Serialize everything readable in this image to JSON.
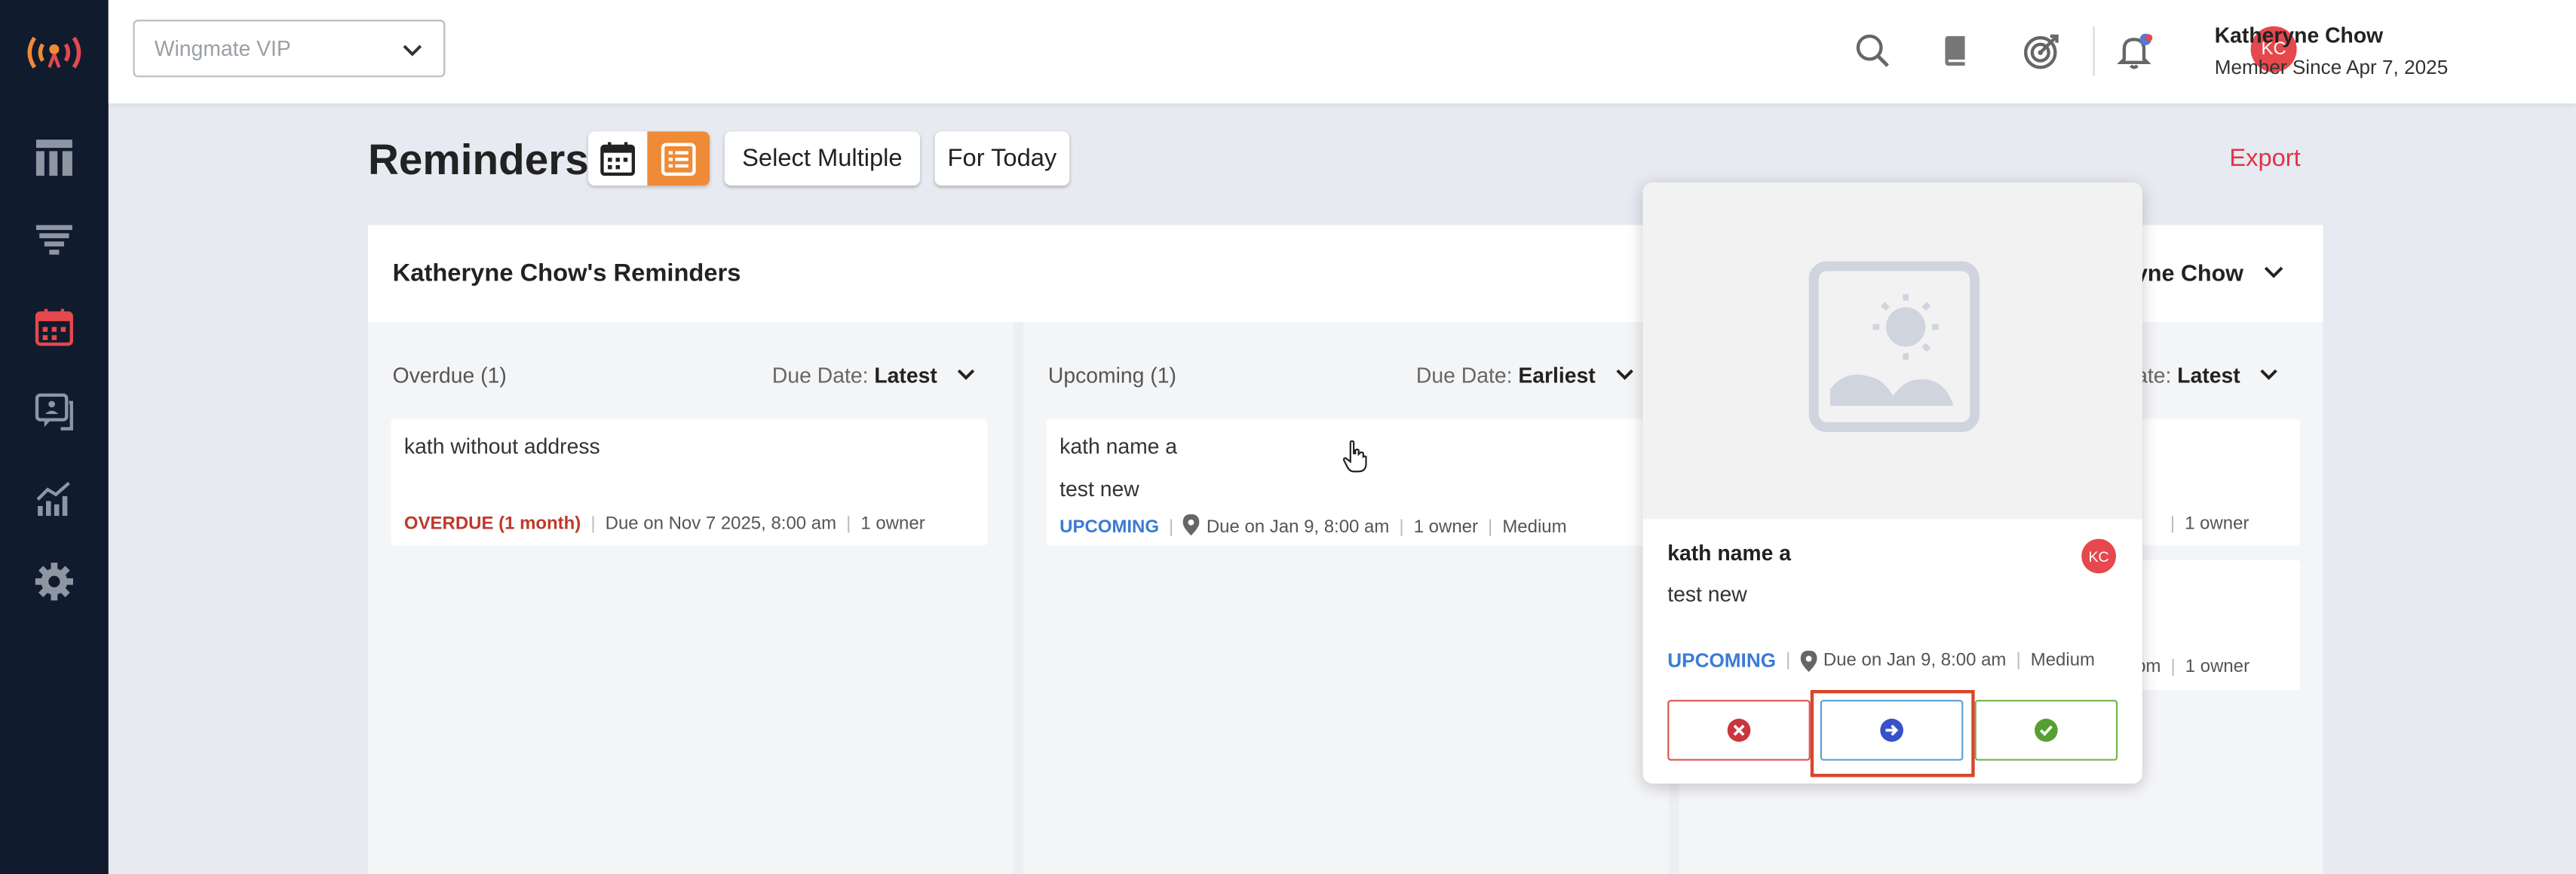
{
  "app": {
    "accent": "#ef8a36",
    "sidebar_bg": "#111b2e"
  },
  "topbar": {
    "org_select": {
      "value": "Wingmate VIP"
    },
    "icons": [
      "search-icon",
      "book-icon",
      "target-icon",
      "bell-icon"
    ],
    "user": {
      "initials": "KC",
      "name": "Katheryne Chow",
      "member_since": "Member Since Apr 7, 2025"
    }
  },
  "sidebar": {
    "items": [
      "dashboard-icon",
      "funnel-icon",
      "calendar-icon",
      "chat-icon",
      "analytics-icon",
      "settings-icon"
    ],
    "active": "calendar-icon"
  },
  "page": {
    "title": "Reminders",
    "select_multiple": "Select Multiple",
    "for_today": "For Today",
    "export": "Export"
  },
  "panel": {
    "title": "Katheryne Chow's Reminders",
    "assignee_visible": "ryne Chow"
  },
  "columns": [
    {
      "header": "Overdue (1)",
      "sort_label": "Due Date:",
      "sort_value": "Latest",
      "cards": [
        {
          "title": "kath without address",
          "status": "OVERDUE (1 month)",
          "due": "Due on Nov 7 2025, 8:00 am",
          "owners": "1 owner"
        }
      ]
    },
    {
      "header": "Upcoming (1)",
      "sort_label": "Due Date:",
      "sort_value": "Earliest",
      "cards": [
        {
          "title": "kath name a",
          "subtitle": "test new",
          "status": "UPCOMING",
          "due": "Due on Jan 9, 8:00 am",
          "owners": "1 owner",
          "priority": "Medium"
        }
      ]
    },
    {
      "header": "",
      "sort_label": "ate:",
      "sort_value": "Latest",
      "cards": [
        {
          "owners": "1 owner"
        },
        {
          "due_partial": "pm",
          "owners": "1 owner"
        }
      ]
    }
  ],
  "popup": {
    "title": "kath name a",
    "avatar": "KC",
    "subtitle": "test new",
    "status": "UPCOMING",
    "due": "Due on Jan 9, 8:00 am",
    "priority": "Medium",
    "actions": [
      "dismiss",
      "reschedule",
      "complete"
    ]
  }
}
